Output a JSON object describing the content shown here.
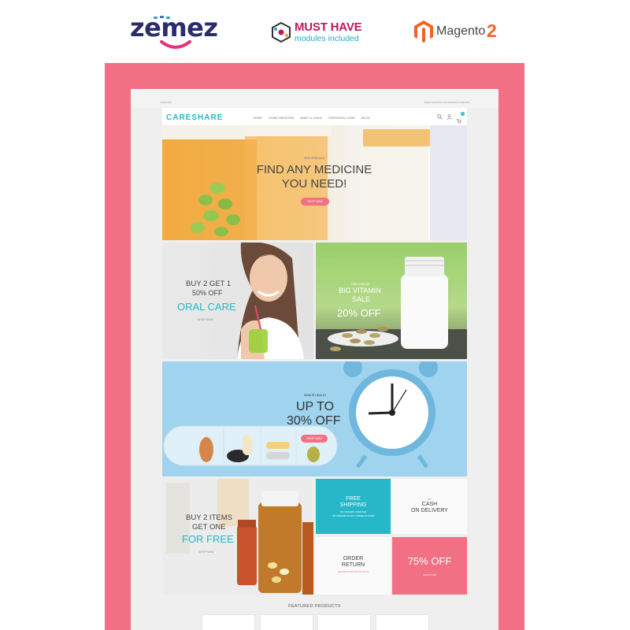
{
  "promo": {
    "zemez": "zemez",
    "musthave_title": "MUST HAVE",
    "musthave_sub": "modules included",
    "magento_text": "Magento",
    "magento_num": "2"
  },
  "theme": {
    "accent_pink": "#f27083",
    "accent_teal": "#26b7c9"
  },
  "store": {
    "topbar_left": "CAREHUB",
    "topbar_right": "FREE SHIPPING ON ORDERS OVER $99",
    "brand": "CARESHARE",
    "menu": [
      "HOME",
      "HOME MEDICINE",
      "BABY & CHILD",
      "PERSONAL CARE",
      "BLOG"
    ],
    "cart_count": "0"
  },
  "hero": {
    "kicker": "NEW ARRIVALS",
    "line1": "FIND ANY MEDICINE",
    "line2": "YOU NEED!",
    "button": "SHOP NOW"
  },
  "oral": {
    "line1": "BUY 2 GET 1",
    "line2": "50% OFF",
    "line3": "ORAL CARE",
    "link": "SHOP NOW"
  },
  "vitamin": {
    "kicker": "ONLY ONLINE",
    "line1": "BIG VITAMIN",
    "line2": "SALE",
    "line3": "20% OFF"
  },
  "pillbox": {
    "kicker": "SENIOR HEALTH",
    "line1": "UP TO",
    "line2": "30% OFF",
    "button": "SHOP NOW"
  },
  "free": {
    "line1": "BUY 2 ITEMS",
    "line2": "GET ONE",
    "line3": "FOR FREE",
    "link": "SHOP NOW"
  },
  "features": {
    "shipping_l1": "FREE",
    "shipping_l2": "SHIPPING",
    "shipping_sub": "ON ORDERS OVER $99",
    "shipping_sub2": "ON ORDERS IN ANY ORDER PLACED",
    "cash_kicker": "PAY",
    "cash_l1": "CASH",
    "cash_l2": "ON DELIVERY",
    "order_l1": "ORDER",
    "order_l2": "RETURN",
    "order_sub": "RETURNS WITHIN 30 DAYS",
    "sale_big": "75% OFF",
    "sale_link": "SHOP NOW"
  },
  "featured": {
    "title": "FEATURED PRODUCTS"
  }
}
